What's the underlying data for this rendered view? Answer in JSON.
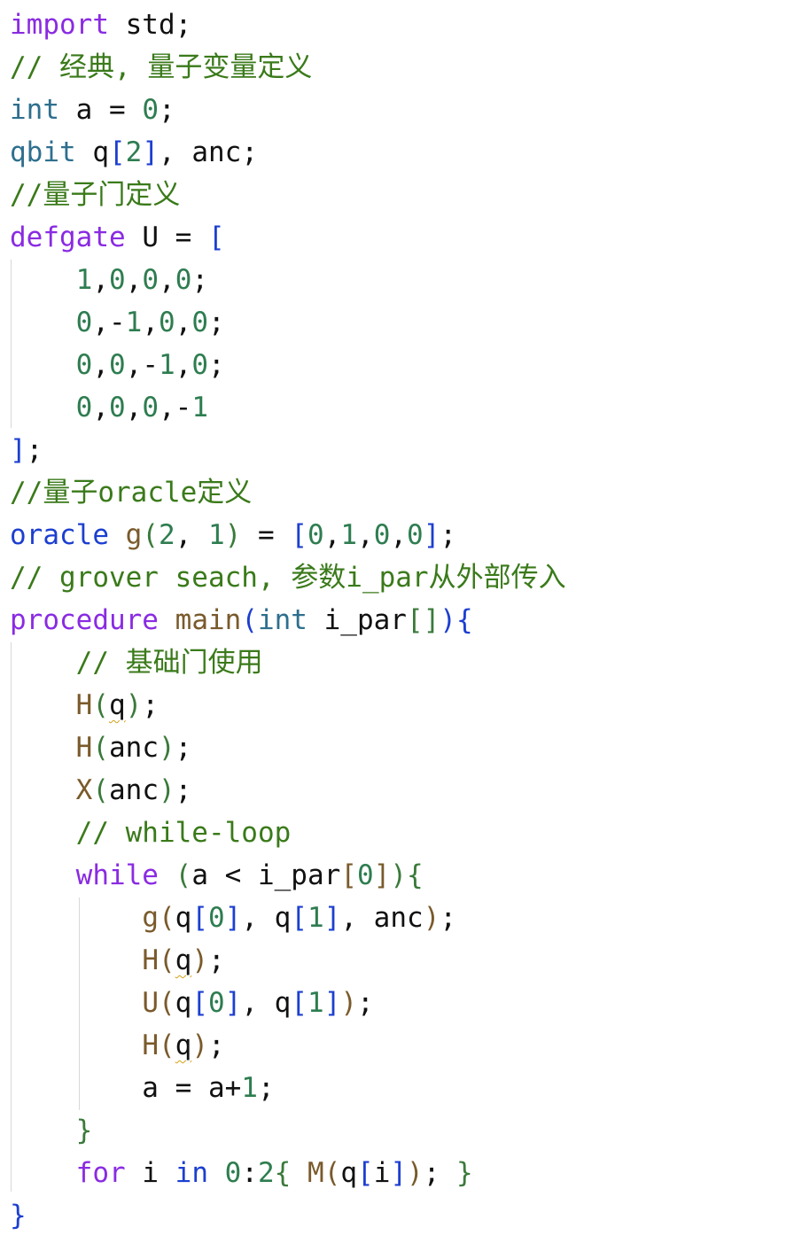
{
  "lines": [
    [
      {
        "t": "import",
        "c": "kw"
      },
      {
        "t": " std;",
        "c": "txt"
      }
    ],
    [
      {
        "t": "// 经典, 量子变量定义",
        "c": "com"
      }
    ],
    [
      {
        "t": "int",
        "c": "type"
      },
      {
        "t": " a = ",
        "c": "txt"
      },
      {
        "t": "0",
        "c": "num"
      },
      {
        "t": ";",
        "c": "txt"
      }
    ],
    [
      {
        "t": "qbit",
        "c": "type"
      },
      {
        "t": " q",
        "c": "txt"
      },
      {
        "t": "[",
        "c": "blue"
      },
      {
        "t": "2",
        "c": "num"
      },
      {
        "t": "]",
        "c": "blue"
      },
      {
        "t": ", anc;",
        "c": "txt"
      }
    ],
    [
      {
        "t": "//量子门定义",
        "c": "com"
      }
    ],
    [
      {
        "t": "defgate",
        "c": "kw"
      },
      {
        "t": " U = ",
        "c": "txt"
      },
      {
        "t": "[",
        "c": "blue"
      }
    ],
    [
      {
        "t": "    ",
        "c": "txt"
      },
      {
        "t": "1",
        "c": "num"
      },
      {
        "t": ",",
        "c": "txt"
      },
      {
        "t": "0",
        "c": "num"
      },
      {
        "t": ",",
        "c": "txt"
      },
      {
        "t": "0",
        "c": "num"
      },
      {
        "t": ",",
        "c": "txt"
      },
      {
        "t": "0",
        "c": "num"
      },
      {
        "t": ";",
        "c": "txt"
      }
    ],
    [
      {
        "t": "    ",
        "c": "txt"
      },
      {
        "t": "0",
        "c": "num"
      },
      {
        "t": ",-",
        "c": "txt"
      },
      {
        "t": "1",
        "c": "num"
      },
      {
        "t": ",",
        "c": "txt"
      },
      {
        "t": "0",
        "c": "num"
      },
      {
        "t": ",",
        "c": "txt"
      },
      {
        "t": "0",
        "c": "num"
      },
      {
        "t": ";",
        "c": "txt"
      }
    ],
    [
      {
        "t": "    ",
        "c": "txt"
      },
      {
        "t": "0",
        "c": "num"
      },
      {
        "t": ",",
        "c": "txt"
      },
      {
        "t": "0",
        "c": "num"
      },
      {
        "t": ",-",
        "c": "txt"
      },
      {
        "t": "1",
        "c": "num"
      },
      {
        "t": ",",
        "c": "txt"
      },
      {
        "t": "0",
        "c": "num"
      },
      {
        "t": ";",
        "c": "txt"
      }
    ],
    [
      {
        "t": "    ",
        "c": "txt"
      },
      {
        "t": "0",
        "c": "num"
      },
      {
        "t": ",",
        "c": "txt"
      },
      {
        "t": "0",
        "c": "num"
      },
      {
        "t": ",",
        "c": "txt"
      },
      {
        "t": "0",
        "c": "num"
      },
      {
        "t": ",-",
        "c": "txt"
      },
      {
        "t": "1",
        "c": "num"
      }
    ],
    [
      {
        "t": "]",
        "c": "blue"
      },
      {
        "t": ";",
        "c": "txt"
      }
    ],
    [
      {
        "t": "//量子oracle定义",
        "c": "com"
      }
    ],
    [
      {
        "t": "oracle",
        "c": "blue"
      },
      {
        "t": " ",
        "c": "txt"
      },
      {
        "t": "g",
        "c": "fn"
      },
      {
        "t": "(",
        "c": "par"
      },
      {
        "t": "2",
        "c": "num"
      },
      {
        "t": ", ",
        "c": "txt"
      },
      {
        "t": "1",
        "c": "num"
      },
      {
        "t": ")",
        "c": "par"
      },
      {
        "t": " = ",
        "c": "txt"
      },
      {
        "t": "[",
        "c": "blue"
      },
      {
        "t": "0",
        "c": "num"
      },
      {
        "t": ",",
        "c": "txt"
      },
      {
        "t": "1",
        "c": "num"
      },
      {
        "t": ",",
        "c": "txt"
      },
      {
        "t": "0",
        "c": "num"
      },
      {
        "t": ",",
        "c": "txt"
      },
      {
        "t": "0",
        "c": "num"
      },
      {
        "t": "]",
        "c": "blue"
      },
      {
        "t": ";",
        "c": "txt"
      }
    ],
    [
      {
        "t": "// grover seach, 参数i_par从外部传入",
        "c": "com"
      }
    ],
    [
      {
        "t": "procedure",
        "c": "kw"
      },
      {
        "t": " ",
        "c": "txt"
      },
      {
        "t": "main",
        "c": "fn"
      },
      {
        "t": "(",
        "c": "blue"
      },
      {
        "t": "int",
        "c": "type"
      },
      {
        "t": " i_par",
        "c": "txt"
      },
      {
        "t": "[]",
        "c": "par"
      },
      {
        "t": ")",
        "c": "blue"
      },
      {
        "t": "{",
        "c": "blue"
      }
    ],
    [
      {
        "t": "    ",
        "c": "txt"
      },
      {
        "t": "// 基础门使用",
        "c": "com"
      }
    ],
    [
      {
        "t": "    ",
        "c": "txt"
      },
      {
        "t": "H",
        "c": "fn"
      },
      {
        "t": "(",
        "c": "par"
      },
      {
        "t": "q",
        "c": "txt",
        "w": true
      },
      {
        "t": ")",
        "c": "par"
      },
      {
        "t": ";",
        "c": "txt"
      }
    ],
    [
      {
        "t": "    ",
        "c": "txt"
      },
      {
        "t": "H",
        "c": "fn"
      },
      {
        "t": "(",
        "c": "par"
      },
      {
        "t": "anc",
        "c": "txt"
      },
      {
        "t": ")",
        "c": "par"
      },
      {
        "t": ";",
        "c": "txt"
      }
    ],
    [
      {
        "t": "    ",
        "c": "txt"
      },
      {
        "t": "X",
        "c": "fn"
      },
      {
        "t": "(",
        "c": "par"
      },
      {
        "t": "anc",
        "c": "txt"
      },
      {
        "t": ")",
        "c": "par"
      },
      {
        "t": ";",
        "c": "txt"
      }
    ],
    [
      {
        "t": "    ",
        "c": "txt"
      },
      {
        "t": "// while-loop",
        "c": "com"
      }
    ],
    [
      {
        "t": "    ",
        "c": "txt"
      },
      {
        "t": "while",
        "c": "kw"
      },
      {
        "t": " ",
        "c": "txt"
      },
      {
        "t": "(",
        "c": "par"
      },
      {
        "t": "a < i_par",
        "c": "txt"
      },
      {
        "t": "[",
        "c": "fn"
      },
      {
        "t": "0",
        "c": "num"
      },
      {
        "t": "]",
        "c": "fn"
      },
      {
        "t": ")",
        "c": "par"
      },
      {
        "t": "{",
        "c": "par"
      }
    ],
    [
      {
        "t": "        ",
        "c": "txt"
      },
      {
        "t": "g",
        "c": "fn"
      },
      {
        "t": "(",
        "c": "fn"
      },
      {
        "t": "q",
        "c": "txt"
      },
      {
        "t": "[",
        "c": "blue"
      },
      {
        "t": "0",
        "c": "num"
      },
      {
        "t": "]",
        "c": "blue"
      },
      {
        "t": ", q",
        "c": "txt"
      },
      {
        "t": "[",
        "c": "blue"
      },
      {
        "t": "1",
        "c": "num"
      },
      {
        "t": "]",
        "c": "blue"
      },
      {
        "t": ", anc",
        "c": "txt"
      },
      {
        "t": ")",
        "c": "fn"
      },
      {
        "t": ";",
        "c": "txt"
      }
    ],
    [
      {
        "t": "        ",
        "c": "txt"
      },
      {
        "t": "H",
        "c": "fn"
      },
      {
        "t": "(",
        "c": "fn"
      },
      {
        "t": "q",
        "c": "txt",
        "w": true
      },
      {
        "t": ")",
        "c": "fn"
      },
      {
        "t": ";",
        "c": "txt"
      }
    ],
    [
      {
        "t": "        ",
        "c": "txt"
      },
      {
        "t": "U",
        "c": "fn"
      },
      {
        "t": "(",
        "c": "fn"
      },
      {
        "t": "q",
        "c": "txt"
      },
      {
        "t": "[",
        "c": "blue"
      },
      {
        "t": "0",
        "c": "num"
      },
      {
        "t": "]",
        "c": "blue"
      },
      {
        "t": ", q",
        "c": "txt"
      },
      {
        "t": "[",
        "c": "blue"
      },
      {
        "t": "1",
        "c": "num"
      },
      {
        "t": "]",
        "c": "blue"
      },
      {
        "t": ")",
        "c": "fn"
      },
      {
        "t": ";",
        "c": "txt"
      }
    ],
    [
      {
        "t": "        ",
        "c": "txt"
      },
      {
        "t": "H",
        "c": "fn"
      },
      {
        "t": "(",
        "c": "fn"
      },
      {
        "t": "q",
        "c": "txt",
        "w": true
      },
      {
        "t": ")",
        "c": "fn"
      },
      {
        "t": ";",
        "c": "txt"
      }
    ],
    [
      {
        "t": "        a = a+",
        "c": "txt"
      },
      {
        "t": "1",
        "c": "num"
      },
      {
        "t": ";",
        "c": "txt"
      }
    ],
    [
      {
        "t": "    ",
        "c": "txt"
      },
      {
        "t": "}",
        "c": "par"
      }
    ],
    [
      {
        "t": "    ",
        "c": "txt"
      },
      {
        "t": "for",
        "c": "kw"
      },
      {
        "t": " i ",
        "c": "txt"
      },
      {
        "t": "in",
        "c": "blue"
      },
      {
        "t": " ",
        "c": "txt"
      },
      {
        "t": "0",
        "c": "num"
      },
      {
        "t": ":",
        "c": "txt"
      },
      {
        "t": "2",
        "c": "num"
      },
      {
        "t": "{",
        "c": "par"
      },
      {
        "t": " ",
        "c": "txt"
      },
      {
        "t": "M",
        "c": "fn"
      },
      {
        "t": "(",
        "c": "fn"
      },
      {
        "t": "q",
        "c": "txt"
      },
      {
        "t": "[",
        "c": "blue"
      },
      {
        "t": "i",
        "c": "txt"
      },
      {
        "t": "]",
        "c": "blue"
      },
      {
        "t": ")",
        "c": "fn"
      },
      {
        "t": "; ",
        "c": "txt"
      },
      {
        "t": "}",
        "c": "par"
      }
    ],
    [
      {
        "t": "}",
        "c": "blue"
      }
    ]
  ]
}
